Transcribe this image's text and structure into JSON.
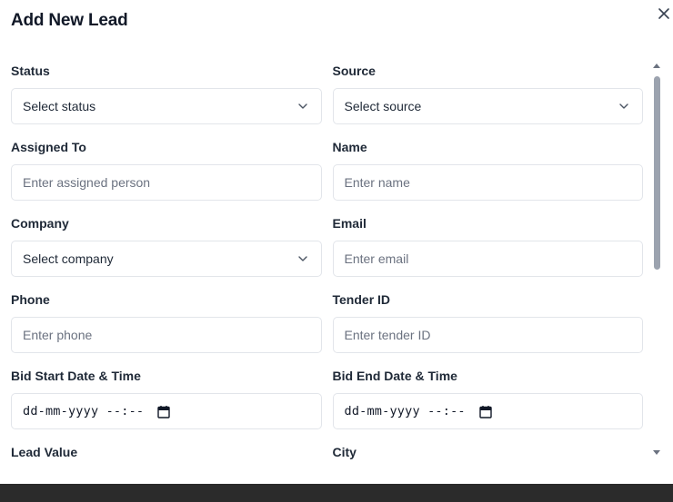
{
  "dialog": {
    "title": "Add New Lead"
  },
  "fields": {
    "status": {
      "label": "Status",
      "value": "Select status"
    },
    "source": {
      "label": "Source",
      "value": "Select source"
    },
    "assigned_to": {
      "label": "Assigned To",
      "placeholder": "Enter assigned person"
    },
    "name": {
      "label": "Name",
      "placeholder": "Enter name"
    },
    "company": {
      "label": "Company",
      "value": "Select company"
    },
    "email": {
      "label": "Email",
      "placeholder": "Enter email"
    },
    "phone": {
      "label": "Phone",
      "placeholder": "Enter phone"
    },
    "tender_id": {
      "label": "Tender ID",
      "placeholder": "Enter tender ID"
    },
    "bid_start": {
      "label": "Bid Start Date & Time",
      "value": "dd-mm-yyyy --:--"
    },
    "bid_end": {
      "label": "Bid End Date & Time",
      "value": "dd-mm-yyyy --:--"
    },
    "lead_value": {
      "label": "Lead Value"
    },
    "city": {
      "label": "City"
    }
  },
  "icons": {
    "close": "close-icon",
    "chevron": "chevron-down-icon",
    "calendar": "calendar-icon"
  },
  "colors": {
    "background_overlay": "#2b2b2b",
    "modal_bg": "#ffffff",
    "border": "#e2e5ea",
    "placeholder": "#6b7280",
    "scrollbar_thumb": "#9ca3af"
  }
}
